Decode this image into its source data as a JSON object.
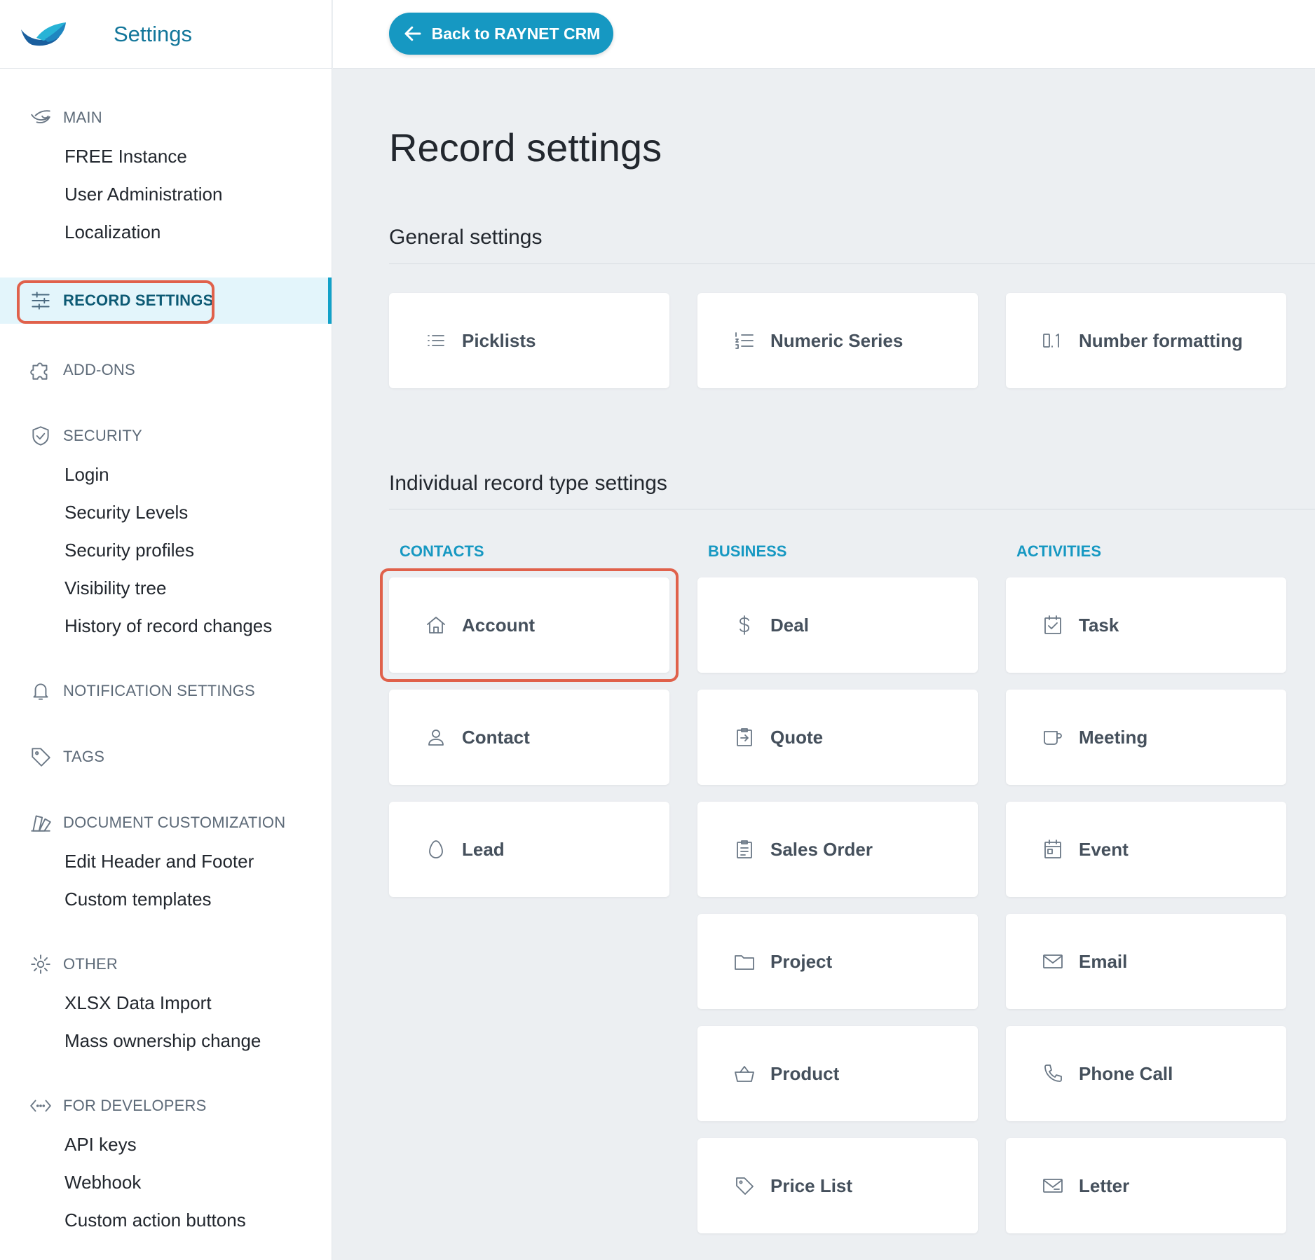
{
  "app": {
    "title": "Settings",
    "accent": "#1698c2",
    "highlight": "#e0614b"
  },
  "topbar": {
    "back_label": "Back to RAYNET CRM",
    "back_icon": "arrow-left-icon"
  },
  "sidebar": {
    "sections": [
      {
        "key": "main",
        "label": "MAIN",
        "icon": "raynet-icon",
        "items": [
          "FREE Instance",
          "User Administration",
          "Localization"
        ]
      },
      {
        "key": "record",
        "label": "RECORD SETTINGS",
        "icon": "sliders-icon",
        "active": true,
        "items": []
      },
      {
        "key": "addons",
        "label": "ADD-ONS",
        "icon": "puzzle-icon",
        "items": []
      },
      {
        "key": "security",
        "label": "SECURITY",
        "icon": "shield-icon",
        "items": [
          "Login",
          "Security Levels",
          "Security profiles",
          "Visibility tree",
          "History of record changes"
        ]
      },
      {
        "key": "notif",
        "label": "NOTIFICATION SETTINGS",
        "icon": "bell-icon",
        "items": []
      },
      {
        "key": "tags",
        "label": "TAGS",
        "icon": "tag-icon",
        "items": []
      },
      {
        "key": "docs",
        "label": "DOCUMENT CUSTOMIZATION",
        "icon": "swatches-icon",
        "items": [
          "Edit Header and Footer",
          "Custom templates"
        ]
      },
      {
        "key": "other",
        "label": "OTHER",
        "icon": "gear-icon",
        "items": [
          "XLSX Data Import",
          "Mass ownership change"
        ]
      },
      {
        "key": "dev",
        "label": "FOR DEVELOPERS",
        "icon": "code-icon",
        "items": [
          "API keys",
          "Webhook",
          "Custom action buttons"
        ]
      }
    ]
  },
  "main": {
    "title": "Record settings",
    "general": {
      "title": "General settings",
      "cards": [
        {
          "label": "Picklists",
          "icon": "list-icon"
        },
        {
          "label": "Numeric Series",
          "icon": "numbered-list-icon"
        },
        {
          "label": "Number formatting",
          "icon": "decimal-icon"
        }
      ]
    },
    "individual": {
      "title": "Individual record type settings",
      "columns": [
        {
          "heading": "CONTACTS",
          "cards": [
            {
              "label": "Account",
              "icon": "home-icon",
              "highlighted": true
            },
            {
              "label": "Contact",
              "icon": "user-icon"
            },
            {
              "label": "Lead",
              "icon": "egg-icon"
            }
          ]
        },
        {
          "heading": "BUSINESS",
          "cards": [
            {
              "label": "Deal",
              "icon": "dollar-icon"
            },
            {
              "label": "Quote",
              "icon": "clipboard-arrow-icon"
            },
            {
              "label": "Sales Order",
              "icon": "clipboard-lines-icon"
            },
            {
              "label": "Project",
              "icon": "folder-icon"
            },
            {
              "label": "Product",
              "icon": "basket-icon"
            },
            {
              "label": "Price List",
              "icon": "tag-icon"
            }
          ]
        },
        {
          "heading": "ACTIVITIES",
          "cards": [
            {
              "label": "Task",
              "icon": "checkbox-icon"
            },
            {
              "label": "Meeting",
              "icon": "cup-icon"
            },
            {
              "label": "Event",
              "icon": "calendar-icon"
            },
            {
              "label": "Email",
              "icon": "envelope-icon"
            },
            {
              "label": "Phone Call",
              "icon": "phone-icon"
            },
            {
              "label": "Letter",
              "icon": "letter-icon"
            }
          ]
        }
      ]
    }
  }
}
